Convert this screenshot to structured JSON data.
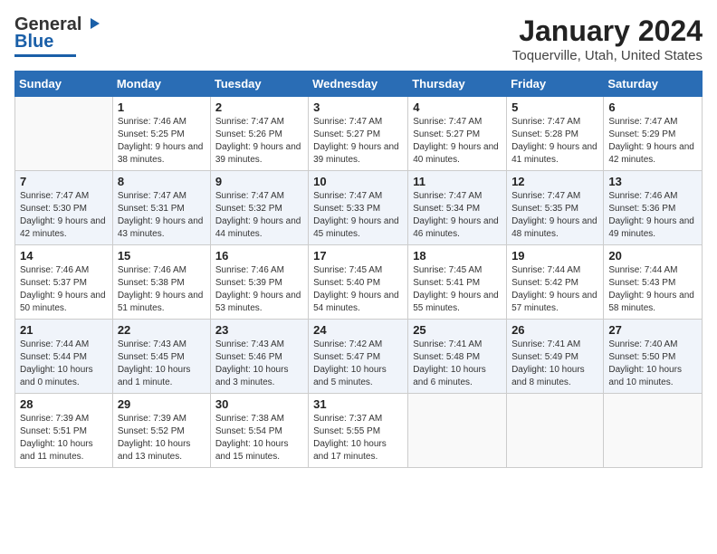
{
  "logo": {
    "line1": "General",
    "line2": "Blue",
    "symbol": "▶"
  },
  "title": "January 2024",
  "location": "Toquerville, Utah, United States",
  "weekdays": [
    "Sunday",
    "Monday",
    "Tuesday",
    "Wednesday",
    "Thursday",
    "Friday",
    "Saturday"
  ],
  "weeks": [
    [
      {
        "day": "",
        "sunrise": "",
        "sunset": "",
        "daylight": ""
      },
      {
        "day": "1",
        "sunrise": "Sunrise: 7:46 AM",
        "sunset": "Sunset: 5:25 PM",
        "daylight": "Daylight: 9 hours and 38 minutes."
      },
      {
        "day": "2",
        "sunrise": "Sunrise: 7:47 AM",
        "sunset": "Sunset: 5:26 PM",
        "daylight": "Daylight: 9 hours and 39 minutes."
      },
      {
        "day": "3",
        "sunrise": "Sunrise: 7:47 AM",
        "sunset": "Sunset: 5:27 PM",
        "daylight": "Daylight: 9 hours and 39 minutes."
      },
      {
        "day": "4",
        "sunrise": "Sunrise: 7:47 AM",
        "sunset": "Sunset: 5:27 PM",
        "daylight": "Daylight: 9 hours and 40 minutes."
      },
      {
        "day": "5",
        "sunrise": "Sunrise: 7:47 AM",
        "sunset": "Sunset: 5:28 PM",
        "daylight": "Daylight: 9 hours and 41 minutes."
      },
      {
        "day": "6",
        "sunrise": "Sunrise: 7:47 AM",
        "sunset": "Sunset: 5:29 PM",
        "daylight": "Daylight: 9 hours and 42 minutes."
      }
    ],
    [
      {
        "day": "7",
        "sunrise": "Sunrise: 7:47 AM",
        "sunset": "Sunset: 5:30 PM",
        "daylight": "Daylight: 9 hours and 42 minutes."
      },
      {
        "day": "8",
        "sunrise": "Sunrise: 7:47 AM",
        "sunset": "Sunset: 5:31 PM",
        "daylight": "Daylight: 9 hours and 43 minutes."
      },
      {
        "day": "9",
        "sunrise": "Sunrise: 7:47 AM",
        "sunset": "Sunset: 5:32 PM",
        "daylight": "Daylight: 9 hours and 44 minutes."
      },
      {
        "day": "10",
        "sunrise": "Sunrise: 7:47 AM",
        "sunset": "Sunset: 5:33 PM",
        "daylight": "Daylight: 9 hours and 45 minutes."
      },
      {
        "day": "11",
        "sunrise": "Sunrise: 7:47 AM",
        "sunset": "Sunset: 5:34 PM",
        "daylight": "Daylight: 9 hours and 46 minutes."
      },
      {
        "day": "12",
        "sunrise": "Sunrise: 7:47 AM",
        "sunset": "Sunset: 5:35 PM",
        "daylight": "Daylight: 9 hours and 48 minutes."
      },
      {
        "day": "13",
        "sunrise": "Sunrise: 7:46 AM",
        "sunset": "Sunset: 5:36 PM",
        "daylight": "Daylight: 9 hours and 49 minutes."
      }
    ],
    [
      {
        "day": "14",
        "sunrise": "Sunrise: 7:46 AM",
        "sunset": "Sunset: 5:37 PM",
        "daylight": "Daylight: 9 hours and 50 minutes."
      },
      {
        "day": "15",
        "sunrise": "Sunrise: 7:46 AM",
        "sunset": "Sunset: 5:38 PM",
        "daylight": "Daylight: 9 hours and 51 minutes."
      },
      {
        "day": "16",
        "sunrise": "Sunrise: 7:46 AM",
        "sunset": "Sunset: 5:39 PM",
        "daylight": "Daylight: 9 hours and 53 minutes."
      },
      {
        "day": "17",
        "sunrise": "Sunrise: 7:45 AM",
        "sunset": "Sunset: 5:40 PM",
        "daylight": "Daylight: 9 hours and 54 minutes."
      },
      {
        "day": "18",
        "sunrise": "Sunrise: 7:45 AM",
        "sunset": "Sunset: 5:41 PM",
        "daylight": "Daylight: 9 hours and 55 minutes."
      },
      {
        "day": "19",
        "sunrise": "Sunrise: 7:44 AM",
        "sunset": "Sunset: 5:42 PM",
        "daylight": "Daylight: 9 hours and 57 minutes."
      },
      {
        "day": "20",
        "sunrise": "Sunrise: 7:44 AM",
        "sunset": "Sunset: 5:43 PM",
        "daylight": "Daylight: 9 hours and 58 minutes."
      }
    ],
    [
      {
        "day": "21",
        "sunrise": "Sunrise: 7:44 AM",
        "sunset": "Sunset: 5:44 PM",
        "daylight": "Daylight: 10 hours and 0 minutes."
      },
      {
        "day": "22",
        "sunrise": "Sunrise: 7:43 AM",
        "sunset": "Sunset: 5:45 PM",
        "daylight": "Daylight: 10 hours and 1 minute."
      },
      {
        "day": "23",
        "sunrise": "Sunrise: 7:43 AM",
        "sunset": "Sunset: 5:46 PM",
        "daylight": "Daylight: 10 hours and 3 minutes."
      },
      {
        "day": "24",
        "sunrise": "Sunrise: 7:42 AM",
        "sunset": "Sunset: 5:47 PM",
        "daylight": "Daylight: 10 hours and 5 minutes."
      },
      {
        "day": "25",
        "sunrise": "Sunrise: 7:41 AM",
        "sunset": "Sunset: 5:48 PM",
        "daylight": "Daylight: 10 hours and 6 minutes."
      },
      {
        "day": "26",
        "sunrise": "Sunrise: 7:41 AM",
        "sunset": "Sunset: 5:49 PM",
        "daylight": "Daylight: 10 hours and 8 minutes."
      },
      {
        "day": "27",
        "sunrise": "Sunrise: 7:40 AM",
        "sunset": "Sunset: 5:50 PM",
        "daylight": "Daylight: 10 hours and 10 minutes."
      }
    ],
    [
      {
        "day": "28",
        "sunrise": "Sunrise: 7:39 AM",
        "sunset": "Sunset: 5:51 PM",
        "daylight": "Daylight: 10 hours and 11 minutes."
      },
      {
        "day": "29",
        "sunrise": "Sunrise: 7:39 AM",
        "sunset": "Sunset: 5:52 PM",
        "daylight": "Daylight: 10 hours and 13 minutes."
      },
      {
        "day": "30",
        "sunrise": "Sunrise: 7:38 AM",
        "sunset": "Sunset: 5:54 PM",
        "daylight": "Daylight: 10 hours and 15 minutes."
      },
      {
        "day": "31",
        "sunrise": "Sunrise: 7:37 AM",
        "sunset": "Sunset: 5:55 PM",
        "daylight": "Daylight: 10 hours and 17 minutes."
      },
      {
        "day": "",
        "sunrise": "",
        "sunset": "",
        "daylight": ""
      },
      {
        "day": "",
        "sunrise": "",
        "sunset": "",
        "daylight": ""
      },
      {
        "day": "",
        "sunrise": "",
        "sunset": "",
        "daylight": ""
      }
    ]
  ]
}
